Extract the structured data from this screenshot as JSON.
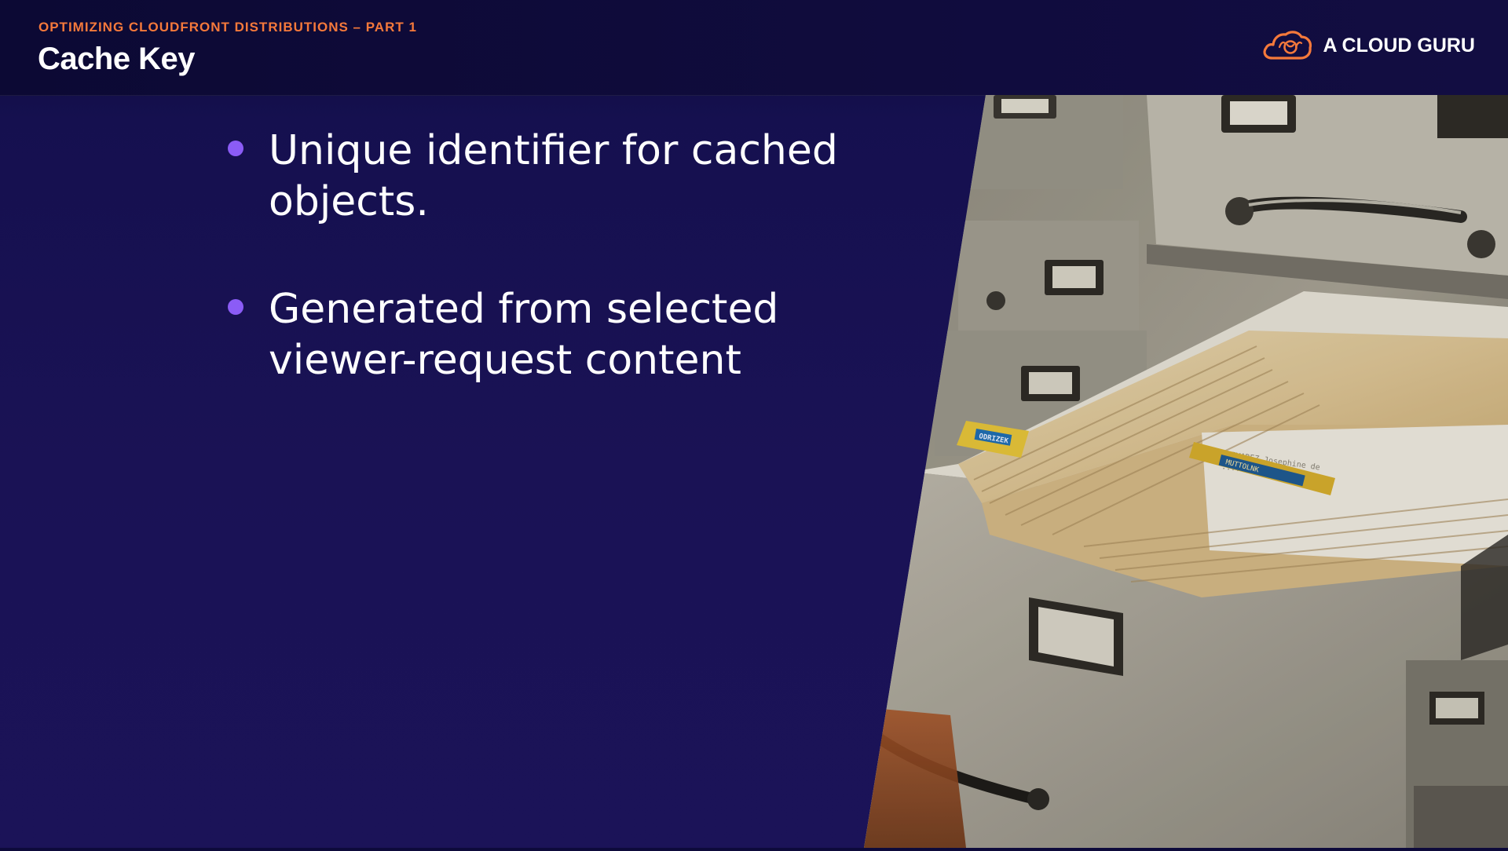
{
  "header": {
    "kicker": "OPTIMIZING CLOUDFRONT DISTRIBUTIONS – PART 1",
    "title": "Cache Key"
  },
  "brand": {
    "name": "A CLOUD GURU",
    "icon": "cloud-logo-icon"
  },
  "bullets": [
    {
      "text": "Unique identifier for cached objects."
    },
    {
      "text": "Generated from selected viewer-request content"
    }
  ],
  "photo": {
    "subject": "open-filing-cabinet-drawer-with-index-cards",
    "tab_labels": [
      "ODRIZEK",
      "MUTTOLNK"
    ]
  },
  "colors": {
    "background": "#1a1255",
    "header_background": "#0f0b3c",
    "kicker": "#f5793b",
    "bullet_dot": "#8b5cf6",
    "logo": "#f5793b",
    "text": "#ffffff"
  }
}
